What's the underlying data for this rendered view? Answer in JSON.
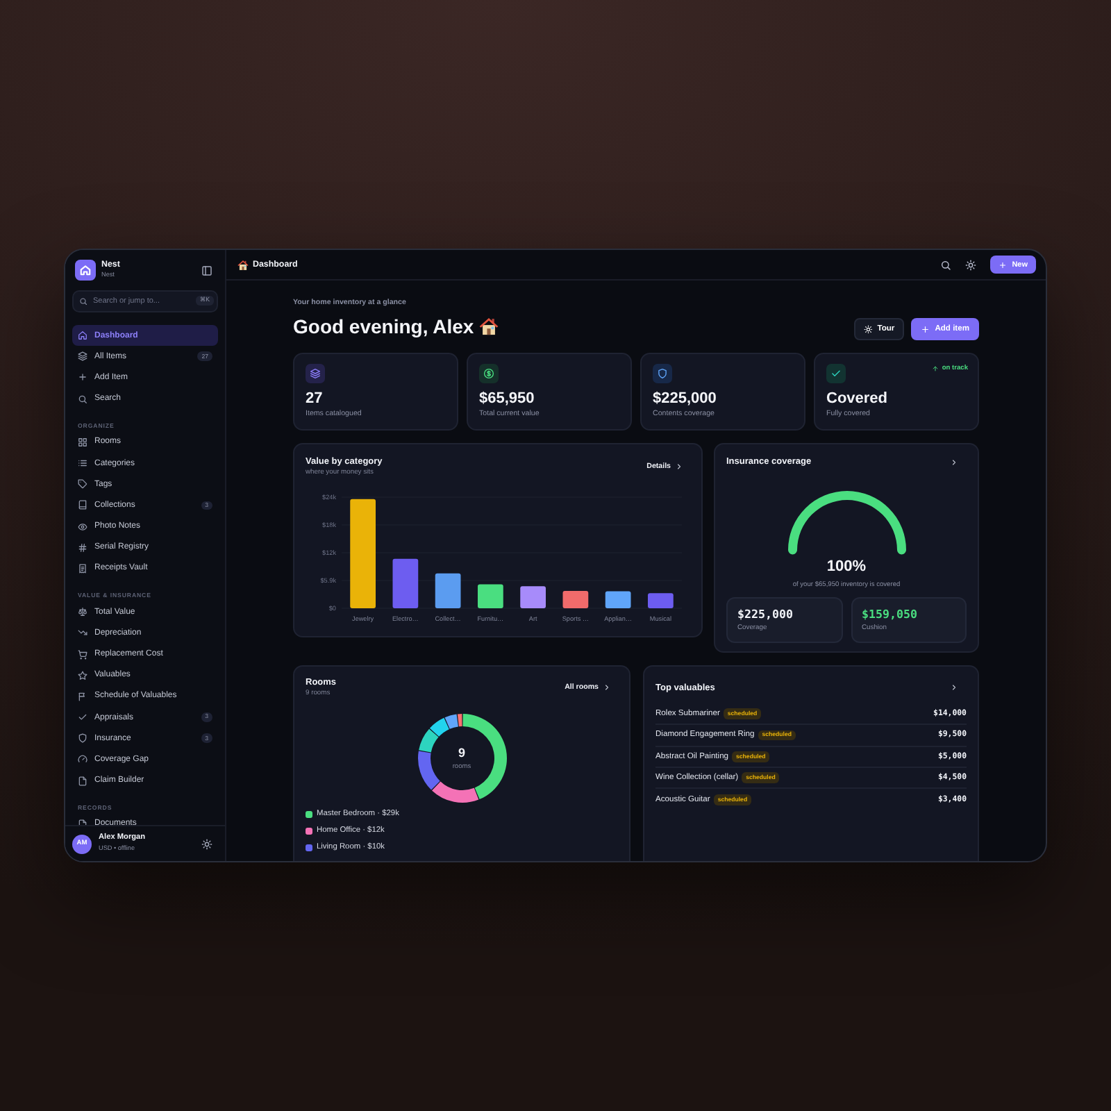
{
  "sidebar": {
    "brand": {
      "name": "Nest",
      "subtitle": "Nest"
    },
    "search": {
      "placeholder": "Search or jump to...",
      "shortcut": "⌘K"
    },
    "sections": [
      {
        "items": [
          {
            "label": "Dashboard",
            "selected": true
          },
          {
            "label": "All Items",
            "selected": false,
            "count": "27"
          },
          {
            "label": "Add Item",
            "selected": false
          },
          {
            "label": "Search",
            "selected": false
          }
        ]
      },
      {
        "heading": "ORGANIZE",
        "items": [
          {
            "label": "Rooms",
            "selected": false
          },
          {
            "label": "Categories",
            "selected": false
          },
          {
            "label": "Tags",
            "selected": false
          },
          {
            "label": "Collections",
            "selected": false,
            "count": "3"
          },
          {
            "label": "Photo Notes",
            "selected": false
          },
          {
            "label": "Serial Registry",
            "selected": false
          },
          {
            "label": "Receipts Vault",
            "selected": false
          }
        ]
      },
      {
        "heading": "VALUE & INSURANCE",
        "items": [
          {
            "label": "Total Value",
            "selected": false
          },
          {
            "label": "Depreciation",
            "selected": false
          },
          {
            "label": "Replacement Cost",
            "selected": false
          },
          {
            "label": "Valuables",
            "selected": false
          },
          {
            "label": "Schedule of Valuables",
            "selected": false
          },
          {
            "label": "Appraisals",
            "selected": false,
            "count": "3"
          },
          {
            "label": "Insurance",
            "selected": false,
            "count": "3"
          },
          {
            "label": "Coverage Gap",
            "selected": false
          },
          {
            "label": "Claim Builder",
            "selected": false
          }
        ]
      },
      {
        "heading": "RECORDS",
        "items": [
          {
            "label": "Documents",
            "selected": false
          }
        ]
      }
    ],
    "user": {
      "initials": "AM",
      "name": "Alex Morgan",
      "status": "USD • offline"
    }
  },
  "topbar": {
    "title": "Dashboard",
    "new_button": "New"
  },
  "header": {
    "eyebrow": "Your home inventory at a glance",
    "greeting": "Good evening, Alex",
    "tour_button": "Tour",
    "add_button": "Add item"
  },
  "stats": [
    {
      "value": "27",
      "label": "Items catalogued"
    },
    {
      "value": "$65,950",
      "label": "Total current value"
    },
    {
      "value": "$225,000",
      "label": "Contents coverage"
    },
    {
      "value": "Covered",
      "label": "Fully covered",
      "trend": "on track"
    }
  ],
  "value_chart": {
    "title": "Value by category",
    "subtitle": "where your money sits",
    "link": "Details",
    "chart_data": {
      "type": "bar",
      "categories": [
        "Jewelry",
        "Electro…",
        "Collect…",
        "Furnitu…",
        "Art",
        "Sports …",
        "Applian…",
        "Musical"
      ],
      "values": [
        23200,
        10500,
        7400,
        5100,
        4700,
        3700,
        3600,
        3200
      ],
      "colors": [
        "#eab308",
        "#6d5df0",
        "#5b9cf0",
        "#4ade80",
        "#a78bfa",
        "#f06b6b",
        "#60a5fa",
        "#6d5df0"
      ],
      "ylim": [
        0,
        23600
      ],
      "yticks": [
        {
          "value": 0,
          "label": "$0"
        },
        {
          "value": 5900,
          "label": "$5.9k"
        },
        {
          "value": 11800,
          "label": "$12k"
        },
        {
          "value": 17700,
          "label": "$18k"
        },
        {
          "value": 23600,
          "label": "$24k"
        }
      ],
      "grid": true
    }
  },
  "insurance": {
    "title": "Insurance coverage",
    "level": 1,
    "percent": "100%",
    "caption": "of your $65,950 inventory is covered",
    "boxes": [
      {
        "kind": "neutral",
        "value": "$225,000",
        "label": "Coverage"
      },
      {
        "kind": "positive",
        "value": "$159,050",
        "label": "Cushion"
      }
    ]
  },
  "rooms": {
    "title": "Rooms",
    "subtitle": "9 rooms",
    "link": "All rooms",
    "center_value": "9",
    "center_label": "rooms",
    "legend": [
      {
        "label": "Master Bedroom · $29k",
        "color": "#4ade80"
      },
      {
        "label": "Home Office · $12k",
        "color": "#f472b6"
      },
      {
        "label": "Living Room · $10k",
        "color": "#6366f1"
      }
    ]
  },
  "valuables": {
    "title": "Top valuables",
    "rows": [
      {
        "name": "Rolex Submariner",
        "status": "scheduled",
        "value": "$14,000"
      },
      {
        "name": "Diamond Engagement Ring",
        "status": "scheduled",
        "value": "$9,500"
      },
      {
        "name": "Abstract Oil Painting",
        "status": "scheduled",
        "value": "$5,000"
      },
      {
        "name": "Wine Collection (cellar)",
        "status": "scheduled",
        "value": "$4,500"
      },
      {
        "name": "Acoustic Guitar",
        "status": "scheduled",
        "value": "$3,400"
      }
    ]
  }
}
